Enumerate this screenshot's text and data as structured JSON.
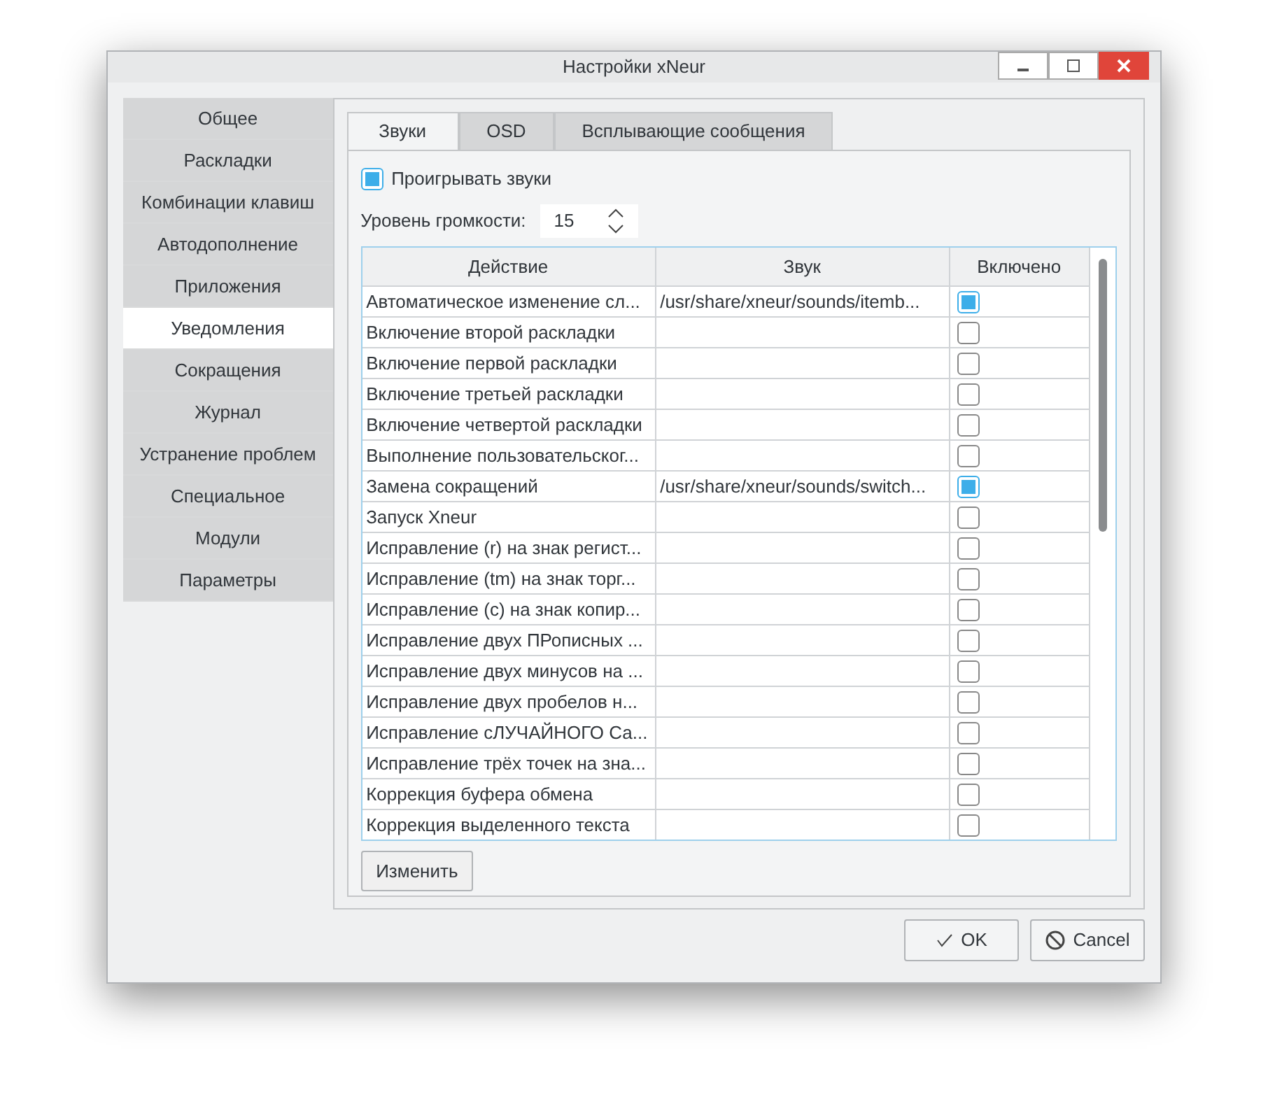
{
  "window": {
    "title": "Настройки xNeur"
  },
  "sidebar": {
    "items": [
      {
        "label": "Общее",
        "selected": false
      },
      {
        "label": "Раскладки",
        "selected": false
      },
      {
        "label": "Комбинации клавиш",
        "selected": false
      },
      {
        "label": "Автодополнение",
        "selected": false
      },
      {
        "label": "Приложения",
        "selected": false
      },
      {
        "label": "Уведомления",
        "selected": true
      },
      {
        "label": "Сокращения",
        "selected": false
      },
      {
        "label": "Журнал",
        "selected": false
      },
      {
        "label": "Устранение проблем",
        "selected": false
      },
      {
        "label": "Специальное",
        "selected": false
      },
      {
        "label": "Модули",
        "selected": false
      },
      {
        "label": "Параметры",
        "selected": false
      }
    ]
  },
  "tabs": [
    {
      "label": "Звуки",
      "selected": true
    },
    {
      "label": "OSD",
      "selected": false
    },
    {
      "label": "Всплывающие сообщения",
      "selected": false
    }
  ],
  "play_sounds": {
    "label": "Проигрывать звуки",
    "checked": true
  },
  "volume": {
    "label": "Уровень громкости:",
    "value": "15"
  },
  "table": {
    "columns": [
      "Действие",
      "Звук",
      "Включено"
    ],
    "rows": [
      {
        "action": "Автоматическое изменение сл...",
        "sound": "/usr/share/xneur/sounds/itemb...",
        "enabled": true
      },
      {
        "action": "Включение второй раскладки",
        "sound": "",
        "enabled": false
      },
      {
        "action": "Включение первой раскладки",
        "sound": "",
        "enabled": false
      },
      {
        "action": "Включение третьей раскладки",
        "sound": "",
        "enabled": false
      },
      {
        "action": "Включение четвертой раскладки",
        "sound": "",
        "enabled": false
      },
      {
        "action": "Выполнение пользовательског...",
        "sound": "",
        "enabled": false
      },
      {
        "action": "Замена сокращений",
        "sound": "/usr/share/xneur/sounds/switch...",
        "enabled": true
      },
      {
        "action": "Запуск Xneur",
        "sound": "",
        "enabled": false
      },
      {
        "action": "Исправление (r) на знак регист...",
        "sound": "",
        "enabled": false
      },
      {
        "action": "Исправление (tm) на знак торг...",
        "sound": "",
        "enabled": false
      },
      {
        "action": "Исправление (c) на знак копир...",
        "sound": "",
        "enabled": false
      },
      {
        "action": "Исправление двух ПРописных ...",
        "sound": "",
        "enabled": false
      },
      {
        "action": "Исправление двух минусов на ...",
        "sound": "",
        "enabled": false
      },
      {
        "action": "Исправление двух пробелов н...",
        "sound": "",
        "enabled": false
      },
      {
        "action": "Исправление сЛУЧАЙНОГО Са...",
        "sound": "",
        "enabled": false
      },
      {
        "action": "Исправление трёх точек на зна...",
        "sound": "",
        "enabled": false
      },
      {
        "action": "Коррекция буфера обмена",
        "sound": "",
        "enabled": false
      },
      {
        "action": "Коррекция выделенного текста",
        "sound": "",
        "enabled": false
      }
    ]
  },
  "edit_button": "Изменить",
  "buttons": [
    {
      "kind": "ok",
      "label": "OK"
    },
    {
      "kind": "cancel",
      "label": "Cancel"
    }
  ]
}
